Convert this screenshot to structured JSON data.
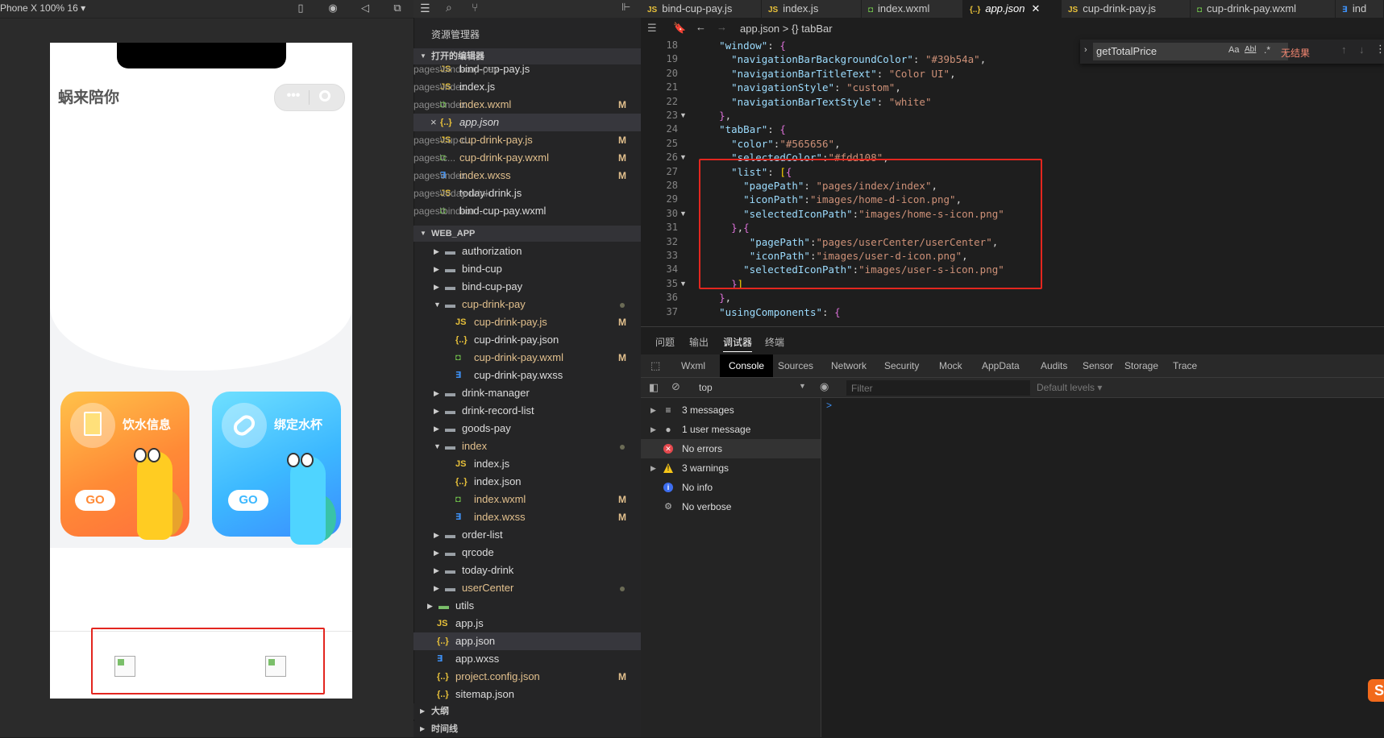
{
  "simulator": {
    "device_label": "Phone X 100% 16",
    "app_title": "蜗来陪你",
    "card_drink_title": "饮水信息",
    "card_bind_title": "绑定水杯",
    "go_label": "GO"
  },
  "explorer": {
    "title": "资源管理器",
    "open_editors_label": "打开的编辑器",
    "project_label": "WEB_APP",
    "outline_label": "大纲",
    "timeline_label": "时间线",
    "open_editors": [
      {
        "name": "bind-cup-pay.js",
        "hint": "pages\\bind-cup-pay",
        "type": "js",
        "badge": ""
      },
      {
        "name": "index.js",
        "hint": "pages\\index",
        "type": "js",
        "badge": ""
      },
      {
        "name": "index.wxml",
        "hint": "pages\\index",
        "type": "wxml",
        "badge": "M"
      },
      {
        "name": "app.json",
        "hint": "",
        "type": "json",
        "badge": ""
      },
      {
        "name": "cup-drink-pay.js",
        "hint": "pages\\cup-d...",
        "type": "js",
        "badge": "M"
      },
      {
        "name": "cup-drink-pay.wxml",
        "hint": "pages\\c...",
        "type": "wxml",
        "badge": "M"
      },
      {
        "name": "index.wxss",
        "hint": "pages\\index",
        "type": "wxss",
        "badge": "M"
      },
      {
        "name": "today-drink.js",
        "hint": "pages\\today-drink",
        "type": "js",
        "badge": ""
      },
      {
        "name": "bind-cup-pay.wxml",
        "hint": "pages\\bind-cu...",
        "type": "wxml",
        "badge": ""
      }
    ],
    "tree": [
      {
        "name": "authorization",
        "kind": "folder",
        "indent": 1,
        "open": false,
        "badge": ""
      },
      {
        "name": "bind-cup",
        "kind": "folder",
        "indent": 1,
        "open": false,
        "badge": ""
      },
      {
        "name": "bind-cup-pay",
        "kind": "folder",
        "indent": 1,
        "open": false,
        "badge": ""
      },
      {
        "name": "cup-drink-pay",
        "kind": "folder",
        "indent": 1,
        "open": true,
        "badge": "dot"
      },
      {
        "name": "cup-drink-pay.js",
        "kind": "js",
        "indent": 2,
        "badge": "M"
      },
      {
        "name": "cup-drink-pay.json",
        "kind": "json",
        "indent": 2,
        "badge": ""
      },
      {
        "name": "cup-drink-pay.wxml",
        "kind": "wxml",
        "indent": 2,
        "badge": "M"
      },
      {
        "name": "cup-drink-pay.wxss",
        "kind": "wxss",
        "indent": 2,
        "badge": ""
      },
      {
        "name": "drink-manager",
        "kind": "folder",
        "indent": 1,
        "open": false,
        "badge": ""
      },
      {
        "name": "drink-record-list",
        "kind": "folder",
        "indent": 1,
        "open": false,
        "badge": ""
      },
      {
        "name": "goods-pay",
        "kind": "folder",
        "indent": 1,
        "open": false,
        "badge": ""
      },
      {
        "name": "index",
        "kind": "folder",
        "indent": 1,
        "open": true,
        "badge": "dot"
      },
      {
        "name": "index.js",
        "kind": "js",
        "indent": 2,
        "badge": ""
      },
      {
        "name": "index.json",
        "kind": "json",
        "indent": 2,
        "badge": ""
      },
      {
        "name": "index.wxml",
        "kind": "wxml",
        "indent": 2,
        "badge": "M"
      },
      {
        "name": "index.wxss",
        "kind": "wxss",
        "indent": 2,
        "badge": "M"
      },
      {
        "name": "order-list",
        "kind": "folder",
        "indent": 1,
        "open": false,
        "badge": ""
      },
      {
        "name": "qrcode",
        "kind": "folder",
        "indent": 1,
        "open": false,
        "badge": ""
      },
      {
        "name": "today-drink",
        "kind": "folder",
        "indent": 1,
        "open": false,
        "badge": ""
      },
      {
        "name": "userCenter",
        "kind": "folder",
        "indent": 1,
        "open": false,
        "badge": "dot"
      },
      {
        "name": "utils",
        "kind": "folder-green",
        "indent": 0,
        "open": false,
        "badge": ""
      },
      {
        "name": "app.js",
        "kind": "js",
        "indent": 0,
        "badge": ""
      },
      {
        "name": "app.json",
        "kind": "json",
        "indent": 0,
        "badge": ""
      },
      {
        "name": "app.wxss",
        "kind": "wxss",
        "indent": 0,
        "badge": ""
      },
      {
        "name": "project.config.json",
        "kind": "json",
        "indent": 0,
        "badge": "M"
      },
      {
        "name": "sitemap.json",
        "kind": "json",
        "indent": 0,
        "badge": ""
      }
    ]
  },
  "editor": {
    "tabs": [
      "bind-cup-pay.js",
      "index.js",
      "index.wxml",
      "app.json",
      "cup-drink-pay.js",
      "cup-drink-pay.wxml",
      "ind"
    ],
    "breadcrumb": "app.json > {} tabBar",
    "find_query": "getTotalPrice",
    "find_result": "无结果",
    "find_opt_case": "Aa",
    "find_opt_word": "Abl",
    "find_opt_regex": ".*",
    "lines": [
      {
        "n": "18",
        "text": "  \"window\": {"
      },
      {
        "n": "19",
        "text": "    \"navigationBarBackgroundColor\": \"#39b54a\","
      },
      {
        "n": "20",
        "text": "    \"navigationBarTitleText\": \"Color UI\","
      },
      {
        "n": "21",
        "text": "    \"navigationStyle\": \"custom\","
      },
      {
        "n": "22",
        "text": "    \"navigationBarTextStyle\": \"white\""
      },
      {
        "n": "23",
        "text": "  },"
      },
      {
        "n": "24",
        "text": "  \"tabBar\": {"
      },
      {
        "n": "25",
        "text": "    \"color\":\"#565656\","
      },
      {
        "n": "26",
        "text": "    \"selectedColor\":\"#fdd108\","
      },
      {
        "n": "27",
        "text": "    \"list\": [{"
      },
      {
        "n": "28",
        "text": "      \"pagePath\": \"pages/index/index\","
      },
      {
        "n": "29",
        "text": "      \"iconPath\":\"images/home-d-icon.png\","
      },
      {
        "n": "30",
        "text": "      \"selectedIconPath\":\"images/home-s-icon.png\""
      },
      {
        "n": "31",
        "text": "    },{"
      },
      {
        "n": "32",
        "text": "       \"pagePath\":\"pages/userCenter/userCenter\","
      },
      {
        "n": "33",
        "text": "       \"iconPath\":\"images/user-d-icon.png\","
      },
      {
        "n": "34",
        "text": "      \"selectedIconPath\":\"images/user-s-icon.png\""
      },
      {
        "n": "35",
        "text": "    }]"
      },
      {
        "n": "36",
        "text": "  },"
      },
      {
        "n": "37",
        "text": "  \"usingComponents\": {"
      }
    ]
  },
  "panel": {
    "tabs": [
      "问题",
      "输出",
      "调试器",
      "终端"
    ],
    "devtools_tabs": [
      "Wxml",
      "Console",
      "Sources",
      "Network",
      "Security",
      "Mock",
      "AppData",
      "Audits",
      "Sensor",
      "Storage",
      "Trace"
    ],
    "context": "top",
    "filter_placeholder": "Filter",
    "levels": "Default levels ▾",
    "console_rows": [
      {
        "label": "3 messages",
        "icon": "list"
      },
      {
        "label": "1 user message",
        "icon": "user"
      },
      {
        "label": "No errors",
        "icon": "error"
      },
      {
        "label": "3 warnings",
        "icon": "warning"
      },
      {
        "label": "No info",
        "icon": "info"
      },
      {
        "label": "No verbose",
        "icon": "verbose"
      }
    ],
    "prompt": ">"
  },
  "colors": {
    "accent_red": "#e3261f",
    "js": "#e8c13a",
    "wxml": "#6fbf4a",
    "wxss": "#3d8ef0",
    "modified": "#e2c08d"
  }
}
